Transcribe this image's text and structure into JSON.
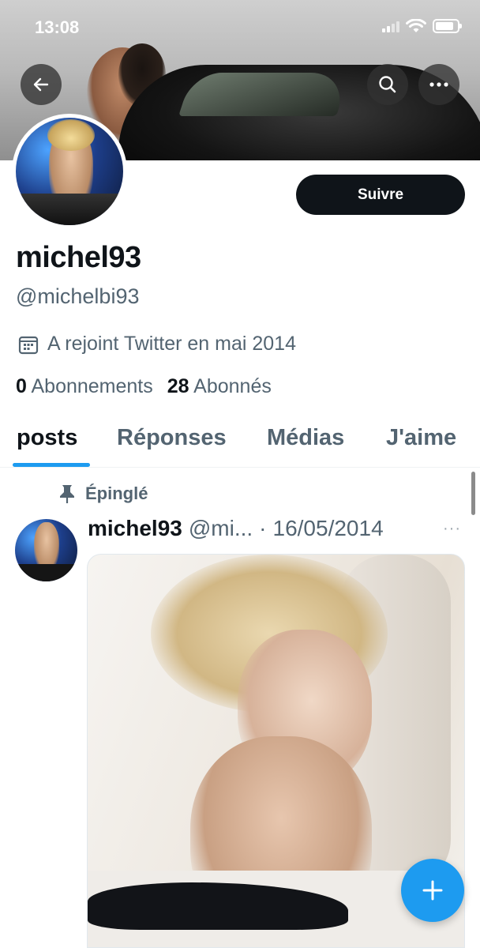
{
  "status_bar": {
    "time": "13:08"
  },
  "profile": {
    "follow_label": "Suivre",
    "display_name": "michel93",
    "handle": "@michelbi93",
    "joined": "A rejoint Twitter en mai 2014",
    "following_count": "0",
    "following_label": "Abonnements",
    "followers_count": "28",
    "followers_label": "Abonnés"
  },
  "tabs": [
    {
      "label": "posts",
      "active": true
    },
    {
      "label": "Réponses",
      "active": false
    },
    {
      "label": "Médias",
      "active": false
    },
    {
      "label": "J'aime",
      "active": false
    }
  ],
  "pinned_post": {
    "pinned_label": "Épinglé",
    "author_name": "michel93",
    "author_handle": "@mi...",
    "separator": "·",
    "date": "16/05/2014",
    "more": "···"
  },
  "icons": {
    "back": "arrow-left-icon",
    "search": "search-icon",
    "more": "more-horizontal-icon",
    "calendar": "calendar-icon",
    "pin": "pin-icon",
    "compose": "plus-icon"
  },
  "colors": {
    "accent": "#1d9bf0",
    "text_primary": "#0f1419",
    "text_secondary": "#536471",
    "follow_button": "#0f1419"
  }
}
